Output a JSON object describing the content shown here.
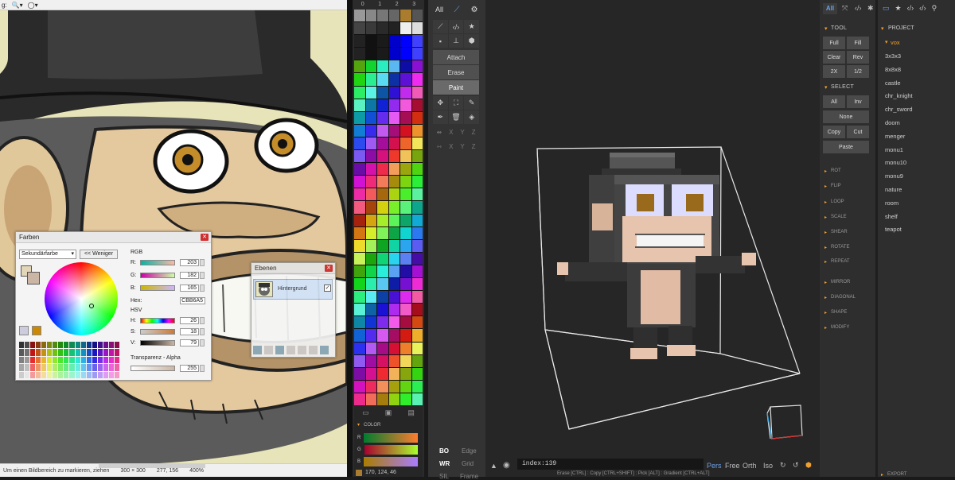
{
  "paint_app": {
    "toolbar_prefix": "g:",
    "status": {
      "hint": "Um einen Bildbereich zu markieren, ziehen",
      "size": "300 × 300",
      "position": "277, 156",
      "zoom": "400%"
    },
    "farben": {
      "title": "Farben",
      "mode": "Sekundärfarbe",
      "less_button": "<< Weniger",
      "rgb_label": "RGB",
      "hsv_label": "HSV",
      "hex_label": "Hex:",
      "hex_value": "CBB6A5",
      "alpha_label": "Transparenz - Alpha",
      "primary_color": "#e2d5b8",
      "secondary_color": "#cbb6a5",
      "rows": [
        {
          "label": "R:",
          "value": "203"
        },
        {
          "label": "G:",
          "value": "182"
        },
        {
          "label": "B:",
          "value": "165"
        },
        {
          "label": "H:",
          "value": "26"
        },
        {
          "label": "S:",
          "value": "18"
        },
        {
          "label": "V:",
          "value": "79"
        }
      ],
      "alpha_value": "255"
    },
    "ebenen": {
      "title": "Ebenen",
      "layer_name": "Hintergrund"
    }
  },
  "palette": {
    "tabs": [
      "0",
      "1",
      "2",
      "3"
    ],
    "bottom_icons": [
      "folder-icon",
      "save-icon",
      "file-icon"
    ],
    "color_section": {
      "label": "COLOR",
      "channels": [
        "R",
        "G",
        "B"
      ],
      "current_rgb": "170, 124, 46"
    }
  },
  "tools": {
    "top_tabs": [
      "All"
    ],
    "attach": "Attach",
    "erase": "Erase",
    "paint": "Paint",
    "axis": [
      "X",
      "Y",
      "Z"
    ],
    "bo": "BO",
    "edge": "Edge",
    "wr": "WR",
    "grid": "Grid",
    "sil": "SIL",
    "frame": "Frame"
  },
  "viewport": {
    "input_value": "index:139",
    "view_modes": [
      "Pers",
      "Free",
      "Orth",
      "Iso"
    ],
    "active_view": "Pers",
    "hint": "Erase [CTRL] : Copy [CTRL+SHIFT] : Pick [ALT] : Gradient [CTRL+ALT]"
  },
  "right_panel": {
    "tab_all": "All",
    "tool_head": "TOOL",
    "tool_buttons": [
      "Full",
      "Fill",
      "Clear",
      "Rev",
      "2X",
      "1/2"
    ],
    "select_head": "SELECT",
    "select_buttons": [
      "All",
      "Inv"
    ],
    "none": "None",
    "copy": "Copy",
    "cut": "Cut",
    "paste": "Paste",
    "sections": [
      "ROT",
      "FLIP",
      "LOOP",
      "SCALE",
      "SHEAR",
      "ROTATE",
      "REPEAT",
      "MIRROR",
      "DIAGONAL",
      "SHAPE",
      "MODIFY"
    ]
  },
  "project": {
    "head": "PROJECT",
    "folder": "vox",
    "items": [
      "3x3x3",
      "8x8x8",
      "castle",
      "chr_knight",
      "chr_sword",
      "doom",
      "menger",
      "monu1",
      "monu10",
      "monu9",
      "nature",
      "room",
      "shelf",
      "teapot"
    ],
    "export": "EXPORT"
  },
  "colors": {
    "accent": "#f0a030",
    "blue_tab": "#6aa0e8",
    "brown_swatch": "#aa7c2e"
  }
}
